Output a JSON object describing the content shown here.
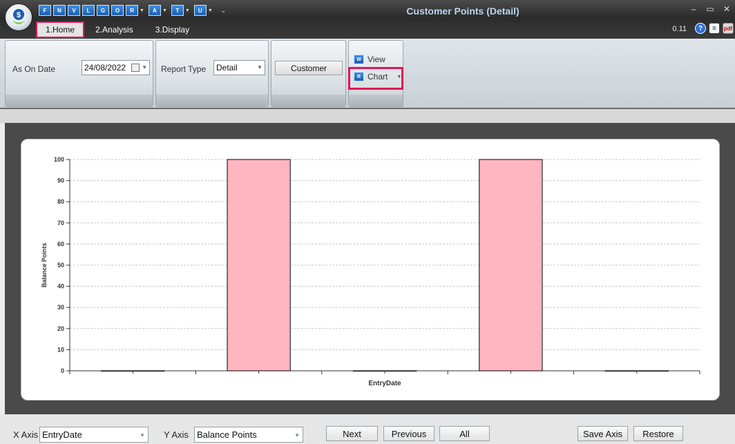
{
  "window": {
    "title": "Customer Points (Detail)",
    "version": "0.11",
    "controls": [
      "–",
      "▭",
      "✕"
    ]
  },
  "quick_access": [
    {
      "label": "F",
      "has_menu": false
    },
    {
      "label": "N",
      "has_menu": false
    },
    {
      "label": "V",
      "has_menu": false
    },
    {
      "label": "L",
      "has_menu": false
    },
    {
      "label": "G",
      "has_menu": false
    },
    {
      "label": "O",
      "has_menu": false
    },
    {
      "label": "R",
      "has_menu": true
    },
    {
      "label": "A",
      "has_menu": true
    },
    {
      "label": "T",
      "has_menu": true
    },
    {
      "label": "U",
      "has_menu": true
    }
  ],
  "tabs": [
    {
      "label": "1.Home",
      "active": true
    },
    {
      "label": "2.Analysis",
      "active": false
    },
    {
      "label": "3.Display",
      "active": false
    }
  ],
  "ribbon": {
    "as_on_date_label": "As On Date",
    "as_on_date_value": "24/08/2022",
    "report_type_label": "Report Type",
    "report_type_value": "Detail",
    "customer_button": "Customer",
    "view_button": "View",
    "chart_button": "Chart",
    "view_icon": "W",
    "chart_icon": "R"
  },
  "chart_data": {
    "type": "bar",
    "categories": [
      "",
      "",
      "",
      "",
      ""
    ],
    "values": [
      0,
      100,
      0,
      100,
      0
    ],
    "xlabel": "EntryDate",
    "ylabel": "Balance Points",
    "ylim": [
      0,
      100
    ],
    "yticks": [
      0,
      10,
      20,
      30,
      40,
      50,
      60,
      70,
      80,
      90,
      100
    ],
    "grid": true,
    "bar_color": "#ffb6c1",
    "bar_edge": "#000000"
  },
  "footer": {
    "x_axis_label": "X Axis",
    "x_axis_value": "EntryDate",
    "y_axis_label": "Y Axis",
    "y_axis_value": "Balance Points",
    "next_button": "Next",
    "previous_button": "Previous",
    "all_button": "All",
    "save_axis_button": "Save Axis",
    "restore_button": "Restore"
  },
  "colors": {
    "highlight": "#e0155a",
    "title_text": "#b9d4ee"
  }
}
